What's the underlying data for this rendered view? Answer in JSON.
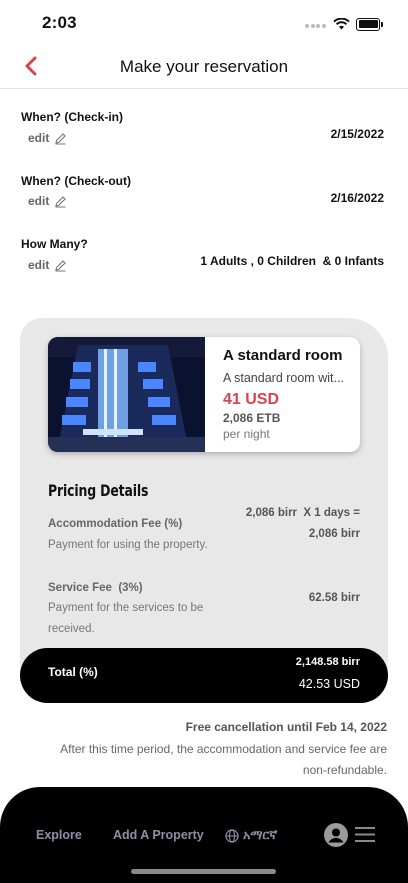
{
  "status_bar": {
    "time": "2:03"
  },
  "header": {
    "title": "Make your reservation"
  },
  "checkin": {
    "label": "When? (Check-in)",
    "edit": "edit",
    "value": "2/15/2022"
  },
  "checkout": {
    "label": "When? (Check-out)",
    "edit": "edit",
    "value": "2/16/2022"
  },
  "guests": {
    "label": "How Many?",
    "edit": "edit",
    "value": "1 Adults , 0 Children  & 0 Infants"
  },
  "room": {
    "name": "A standard room",
    "description": "A standard room wit...",
    "price_usd": "41 USD",
    "price_etb": "2,086 ETB",
    "per": "per night"
  },
  "pricing": {
    "title": "Pricing Details",
    "accommodation_label": "Accommodation Fee (%)",
    "accommodation_desc": "Payment for using the property.",
    "accommodation_calc_line1": "2,086 birr  X 1 days =",
    "accommodation_calc_line2": "2,086 birr",
    "service_label": "Service Fee  (3%)",
    "service_desc_line1": "Payment for the services to be",
    "service_desc_line2": "received.",
    "service_amount": "62.58 birr",
    "total_label": "Total (%)",
    "total_birr": "2,148.58 birr",
    "total_usd": "42.53 USD"
  },
  "cancellation": {
    "title": "Free cancellation until Feb 14, 2022",
    "note": "After this time period, the accommodation and service fee are non-refundable."
  },
  "nav": {
    "explore": "Explore",
    "add_property": "Add A Property",
    "language": "አማርኛ"
  },
  "colors": {
    "accent": "#d9434f",
    "nav_text": "#8f8ea8"
  }
}
